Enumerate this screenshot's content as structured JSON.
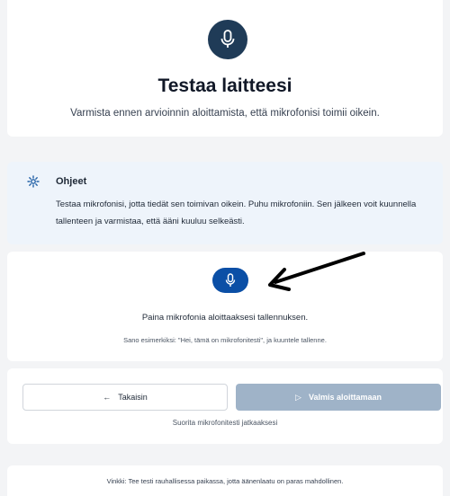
{
  "header": {
    "icon": "microphone-icon",
    "title": "Testaa laitteesi",
    "subtitle": "Varmista ennen arvioinnin aloittamista, että mikrofonisi toimii oikein."
  },
  "instructions": {
    "icon": "gear-icon",
    "title": "Ohjeet",
    "text": "Testaa mikrofonisi, jotta tiedät sen toimivan oikein. Puhu mikrofoniin. Sen jälkeen voit kuunnella tallenteen ja varmistaa, että ääni kuuluu selkeästi."
  },
  "mic": {
    "icon": "microphone-icon",
    "prompt": "Paina mikrofonia aloittaaksesi tallennuksen.",
    "example": "Sano esimerkiksi: \"Hei, tämä on mikrofonitesti\", ja kuuntele tallenne."
  },
  "actions": {
    "back_label": "Takaisin",
    "back_icon": "←",
    "ready_label": "Valmis aloittamaan",
    "ready_icon": "▷",
    "hint": "Suorita mikrofonitesti jatkaaksesi"
  },
  "tip": {
    "text": "Vinkki: Tee testi rauhallisessa paikassa, jotta äänenlaatu on paras mahdollinen."
  },
  "colors": {
    "hero_icon_bg": "#1f3b57",
    "mic_button_bg": "#0b4fa6",
    "ready_button_bg": "#9fb3c8",
    "instructions_bg": "#eef4fb"
  }
}
